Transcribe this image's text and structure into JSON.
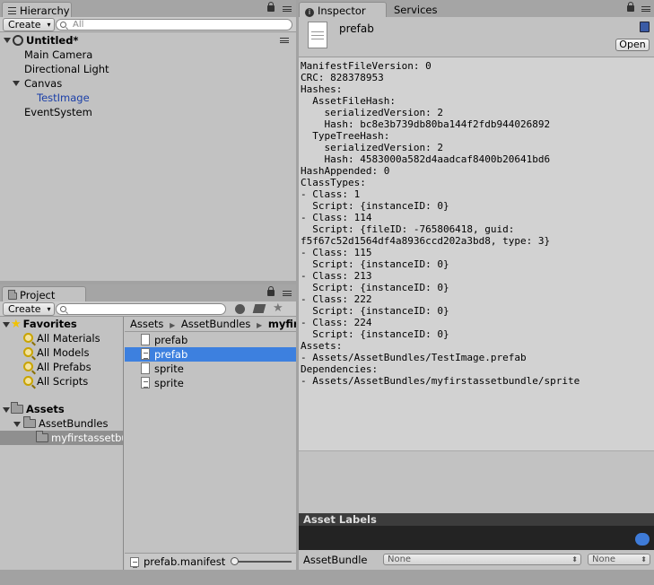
{
  "hierarchy": {
    "tab_label": "Hierarchy",
    "create_label": "Create",
    "search_placeholder": "All",
    "scene_name": "Untitled*",
    "items": [
      {
        "label": "Main Camera"
      },
      {
        "label": "Directional Light"
      },
      {
        "label": "Canvas"
      },
      {
        "label": "TestImage"
      },
      {
        "label": "EventSystem"
      }
    ]
  },
  "project": {
    "tab_label": "Project",
    "create_label": "Create",
    "favorites_label": "Favorites",
    "favorites": [
      "All Materials",
      "All Models",
      "All Prefabs",
      "All Scripts"
    ],
    "assets_label": "Assets",
    "folders": [
      "AssetBundles",
      "myfirstassetbundle"
    ],
    "breadcrumb": [
      "Assets",
      "AssetBundles",
      "myfirstassetbundle"
    ],
    "files": [
      {
        "label": "prefab",
        "selected": false
      },
      {
        "label": "prefab",
        "selected": true
      },
      {
        "label": "sprite",
        "selected": false
      },
      {
        "label": "sprite",
        "selected": false
      }
    ],
    "status_file": "prefab.manifest"
  },
  "inspector": {
    "tab_label": "Inspector",
    "services_tab": "Services",
    "asset_name": "prefab",
    "open_label": "Open",
    "manifest_lines": [
      "ManifestFileVersion: 0",
      "CRC: 828378953",
      "Hashes:",
      "  AssetFileHash:",
      "    serializedVersion: 2",
      "    Hash: bc8e3b739db80ba144f2fdb944026892",
      "  TypeTreeHash:",
      "    serializedVersion: 2",
      "    Hash: 4583000a582d4aadcaf8400b20641bd6",
      "HashAppended: 0",
      "ClassTypes:",
      "- Class: 1",
      "  Script: {instanceID: 0}",
      "- Class: 114",
      "  Script: {fileID: -765806418, guid:",
      "f5f67c52d1564df4a8936ccd202a3bd8, type: 3}",
      "- Class: 115",
      "  Script: {instanceID: 0}",
      "- Class: 213",
      "  Script: {instanceID: 0}",
      "- Class: 222",
      "  Script: {instanceID: 0}",
      "- Class: 224",
      "  Script: {instanceID: 0}",
      "Assets:",
      "- Assets/AssetBundles/TestImage.prefab",
      "Dependencies:",
      "- Assets/AssetBundles/myfirstassetbundle/sprite"
    ],
    "asset_labels_title": "Asset Labels",
    "assetbundle_label": "AssetBundle",
    "assetbundle_value": "None",
    "variant_value": "None"
  },
  "colors": {
    "selection": "#3d80df",
    "panel": "#c2c2c2",
    "labels_bar": "#232323"
  }
}
